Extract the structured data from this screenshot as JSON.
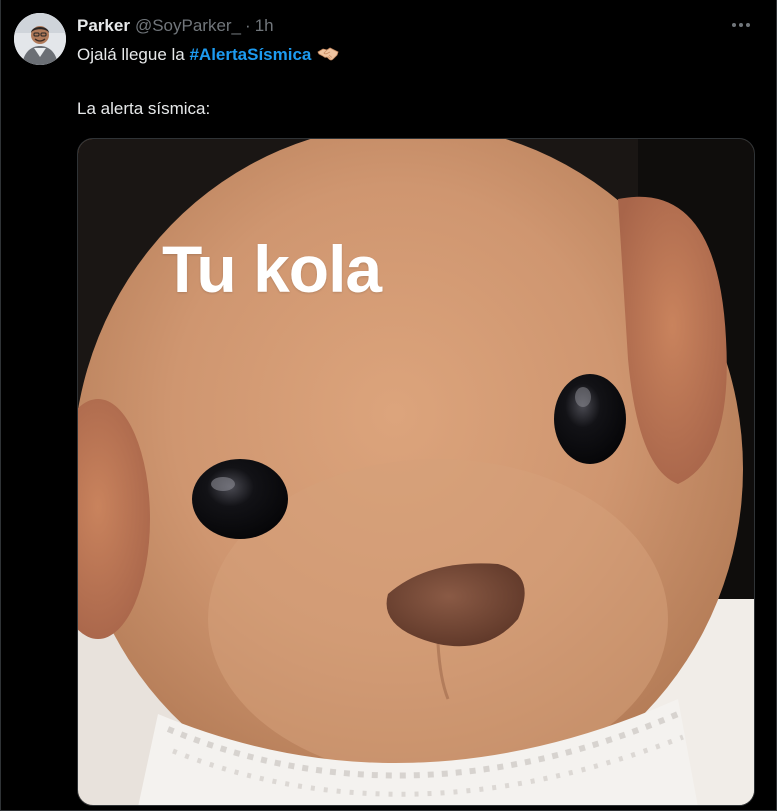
{
  "tweet": {
    "author_name": "Parker",
    "author_handle": "@SoyParker_",
    "separator": "·",
    "time": "1h",
    "text_prefix": "Ojalá llegue la ",
    "hashtag": "#AlertaSísmica",
    "text_line2": "La alerta sísmica:",
    "emoji_icon": "handshake-icon",
    "more_icon": "more-options-icon"
  },
  "media": {
    "caption": "Tu kola"
  },
  "colors": {
    "background": "#000000",
    "text": "#e7e9ea",
    "secondary_text": "#71767b",
    "link": "#1d9bf0",
    "border": "#2f3336"
  }
}
